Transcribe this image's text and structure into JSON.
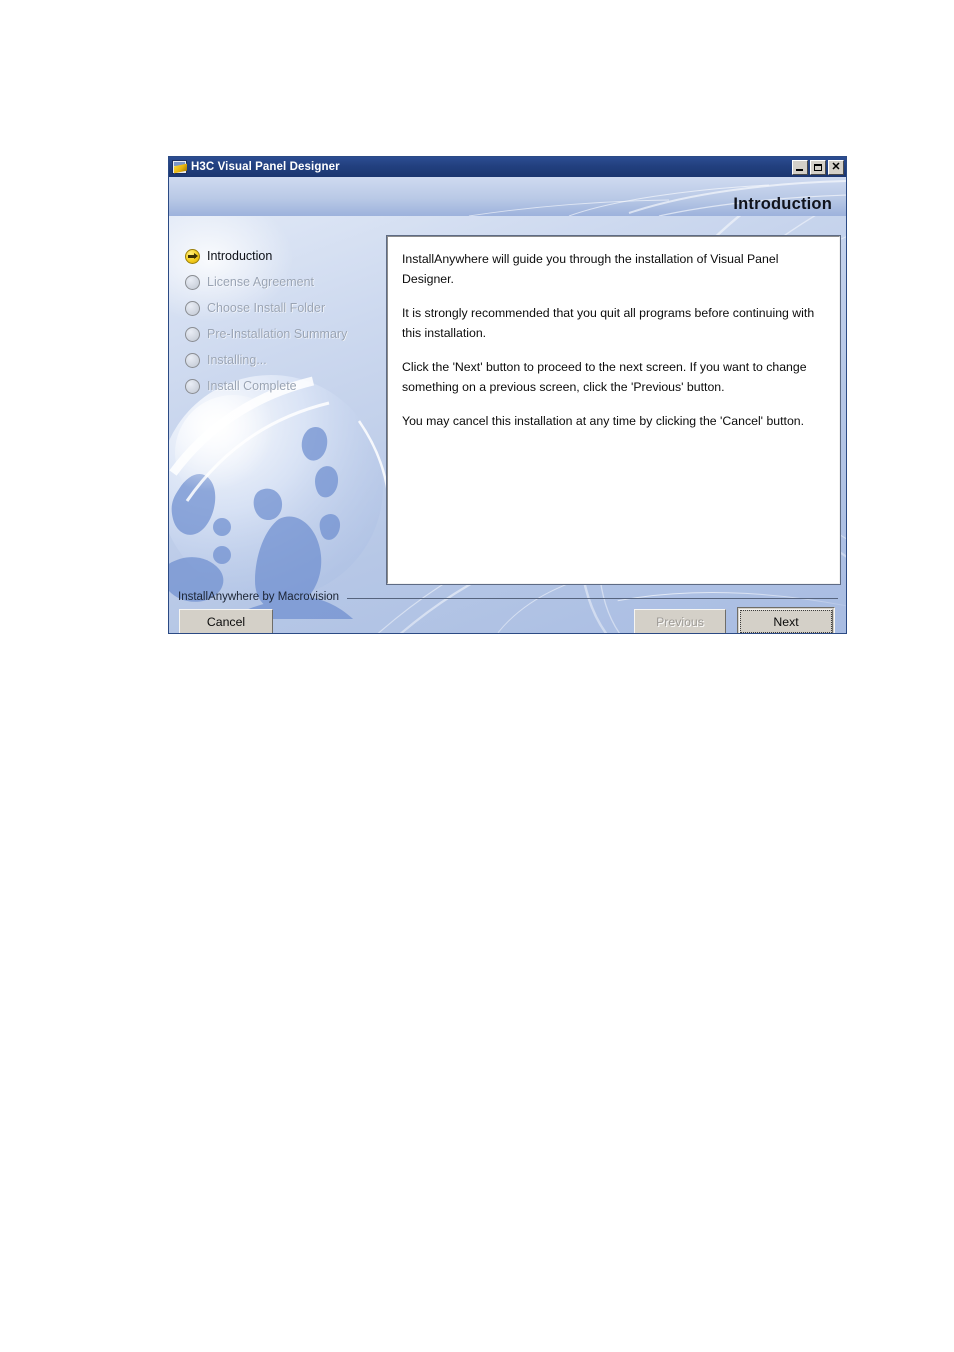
{
  "window": {
    "title": "H3C Visual Panel Designer",
    "app_icon": "document-pencil-icon",
    "controls": {
      "minimize": "minimize-icon",
      "maximize": "maximize-icon",
      "close": "close-icon"
    }
  },
  "header": {
    "page_title": "Introduction"
  },
  "sidebar": {
    "steps": [
      {
        "label": "Introduction",
        "state": "active"
      },
      {
        "label": "License Agreement",
        "state": "pending"
      },
      {
        "label": "Choose Install Folder",
        "state": "pending"
      },
      {
        "label": "Pre-Installation Summary",
        "state": "pending"
      },
      {
        "label": "Installing...",
        "state": "pending"
      },
      {
        "label": "Install Complete",
        "state": "pending"
      }
    ]
  },
  "content": {
    "paragraphs": [
      "InstallAnywhere will guide you through the installation of Visual Panel Designer.",
      "It is strongly recommended that you quit all programs before continuing with this installation.",
      "Click the 'Next' button to proceed to the next screen. If you want to change something on a previous screen, click the 'Previous' button.",
      "You may cancel this installation at any time by clicking the 'Cancel' button."
    ]
  },
  "footer": {
    "brand": "InstallAnywhere by Macrovision",
    "cancel_label": "Cancel",
    "previous_label": "Previous",
    "next_label": "Next",
    "previous_enabled": false,
    "next_focused": true
  },
  "colors": {
    "titlebar": "#22407f",
    "window_bg": "#b6c7e6",
    "panel_bg": "#ffffff",
    "active_bullet": "#f5cf20",
    "pending_label": "#9aa4b4",
    "button_face": "#d4d0c8"
  }
}
